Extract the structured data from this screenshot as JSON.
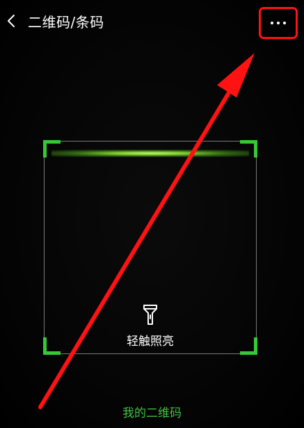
{
  "header": {
    "title": "二维码/条码",
    "back_icon": "chevron-left-icon",
    "more_icon": "more-dots-icon"
  },
  "scanner": {
    "torch_icon": "flashlight-icon",
    "torch_label": "轻触照亮"
  },
  "footer": {
    "my_qr_label": "我的二维码"
  },
  "colors": {
    "accent_green": "#37c837",
    "annotation_red": "#ff1212",
    "background": "#000000"
  }
}
